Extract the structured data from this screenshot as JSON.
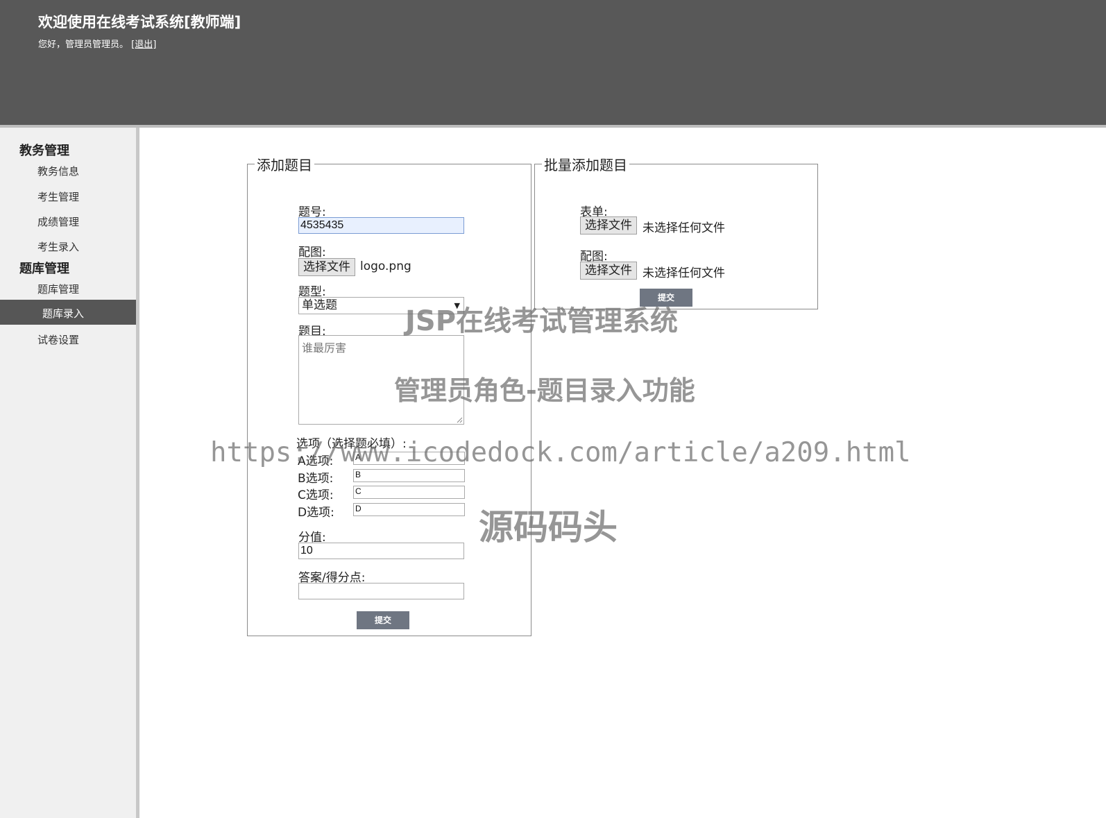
{
  "header": {
    "title": "欢迎使用在线考试系统[教师端]",
    "greeting": "您好，管理员管理员。",
    "logout_label": "[退出]"
  },
  "sidebar": {
    "groups": [
      {
        "label": "教务管理",
        "items": [
          "教务信息",
          "考生管理",
          "成绩管理",
          "考生录入"
        ]
      },
      {
        "label": "题库管理",
        "items": [
          "题库管理",
          "题库录入",
          "试卷设置"
        ]
      }
    ],
    "active_item": "题库录入"
  },
  "add_form": {
    "legend": "添加题目",
    "id_label": "题号:",
    "id_value": "4535435",
    "image_label": "配图:",
    "file_button_label": "选择文件",
    "image_file": "logo.png",
    "type_label": "题型:",
    "type_value": "单选题",
    "question_label": "题目:",
    "question_value": "谁最厉害",
    "options_label": "选项（选择题必填）:",
    "options": [
      {
        "label": "A选项:",
        "value": "A"
      },
      {
        "label": "B选项:",
        "value": "B"
      },
      {
        "label": "C选项:",
        "value": "C"
      },
      {
        "label": "D选项:",
        "value": "D"
      }
    ],
    "score_label": "分值:",
    "score_value": "10",
    "answer_label": "答案/得分点:",
    "answer_value": "",
    "submit_label": "提交"
  },
  "batch_form": {
    "legend": "批量添加题目",
    "sheet_label": "表单:",
    "file_button_label": "选择文件",
    "sheet_file": "未选择任何文件",
    "image_label": "配图:",
    "image_file": "未选择任何文件",
    "submit_label": "提交"
  },
  "watermark": {
    "line1": "JSP在线考试管理系统",
    "line2": "管理员角色-题目录入功能",
    "line3": "https://www.icodedock.com/article/a209.html",
    "line4": "源码码头"
  }
}
